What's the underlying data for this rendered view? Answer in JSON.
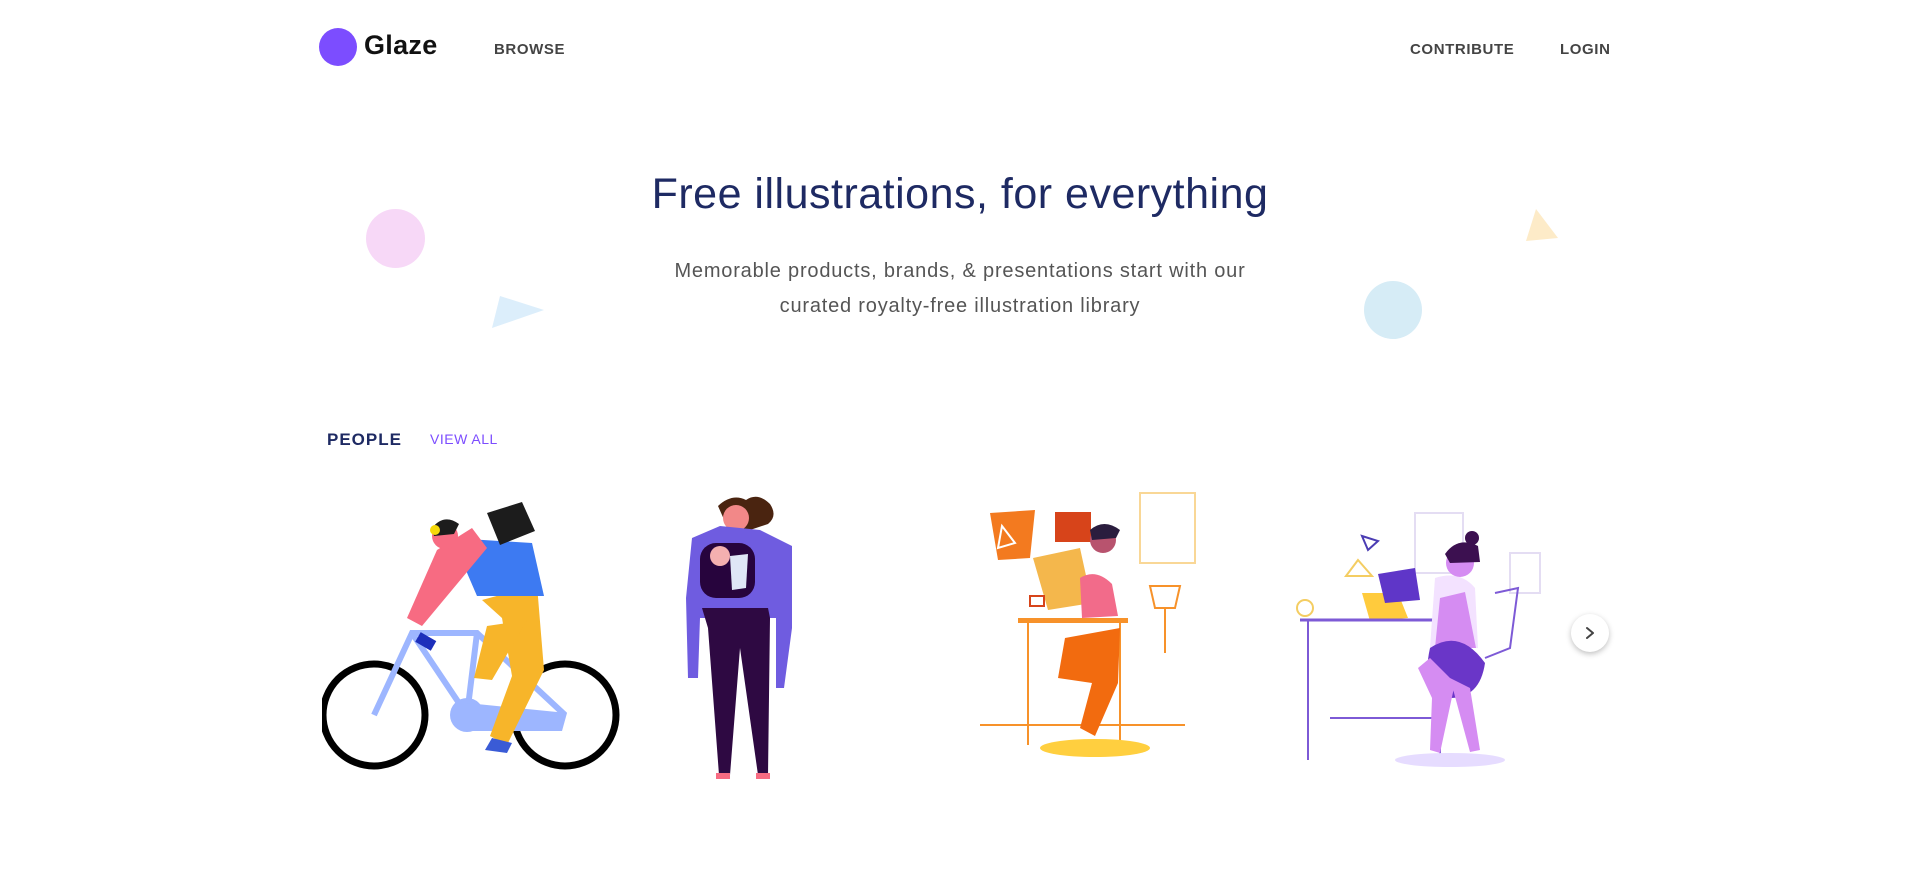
{
  "header": {
    "logo_text": "Glaze",
    "nav": {
      "browse": "BROWSE",
      "contribute": "CONTRIBUTE",
      "login": "LOGIN"
    }
  },
  "hero": {
    "title": "Free illustrations, for everything",
    "subtitle_line1": "Memorable products, brands, & presentations start with our",
    "subtitle_line2": "curated royalty-free illustration library"
  },
  "section": {
    "label": "PEOPLE",
    "view_all": "VIEW ALL"
  },
  "cards": [
    {
      "icon": "cyclist-illustration"
    },
    {
      "icon": "parent-with-baby-carrier-illustration"
    },
    {
      "icon": "designer-at-desk-illustration"
    },
    {
      "icon": "woman-at-laptop-illustration"
    }
  ],
  "carousel": {
    "next_icon": "chevron-right-icon"
  },
  "colors": {
    "brand": "#7c4dff",
    "heading": "#1e2a63",
    "text": "#555555"
  }
}
